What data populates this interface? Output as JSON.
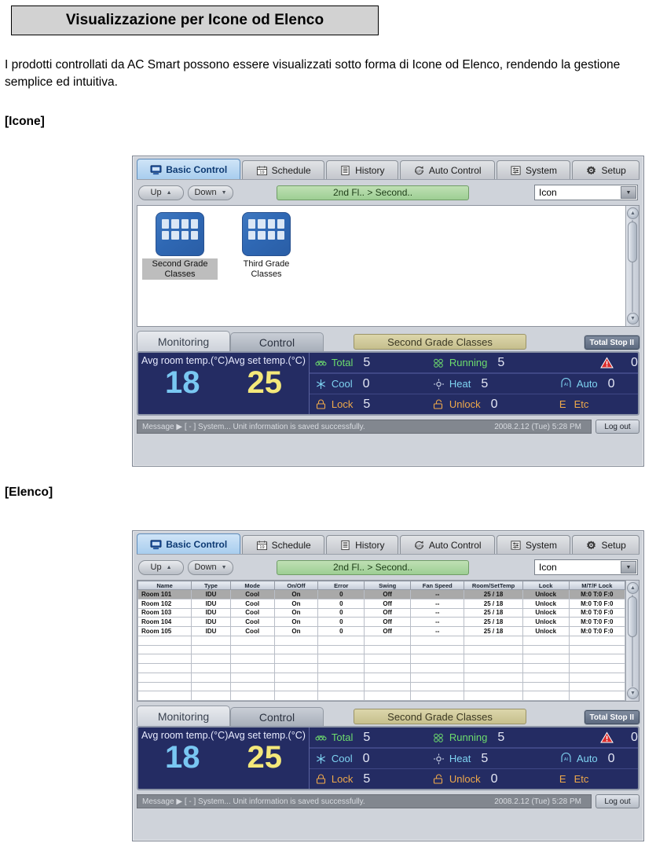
{
  "document": {
    "title": "Visualizzazione per Icone od Elenco",
    "paragraph": "I prodotti controllati da AC Smart possono essere visualizzati sotto forma di Icone od Elenco, rendendo la gestione semplice ed intuitiva.",
    "section_icons_label": "[Icone]",
    "section_list_label": "[Elenco]"
  },
  "app": {
    "tabs": [
      {
        "label": "Basic Control",
        "icon": "monitor-icon",
        "active": true
      },
      {
        "label": "Schedule",
        "icon": "calendar-icon",
        "active": false
      },
      {
        "label": "History",
        "icon": "list-document-icon",
        "active": false
      },
      {
        "label": "Auto Control",
        "icon": "auto-cycle-icon",
        "active": false
      },
      {
        "label": "System",
        "icon": "sliders-icon",
        "active": false
      },
      {
        "label": "Setup",
        "icon": "gear-icon",
        "active": false
      }
    ],
    "toolbar": {
      "up_label": "Up",
      "down_label": "Down",
      "location": "2nd Fl.. > Second..",
      "view_mode": "Icon"
    },
    "icons_view": {
      "folders": [
        {
          "label": "Second Grade Classes",
          "selected": true
        },
        {
          "label": "Third Grade Classes",
          "selected": false
        }
      ]
    },
    "list_view": {
      "columns": [
        "Name",
        "Type",
        "Mode",
        "On/Off",
        "Error",
        "Swing",
        "Fan Speed",
        "Room/SetTemp",
        "Lock",
        "M/T/F Lock"
      ],
      "rows": [
        {
          "cells": [
            "Room 101",
            "IDU",
            "Cool",
            "On",
            "0",
            "Off",
            "--",
            "25 / 18",
            "Unlock",
            "M:0 T:0 F:0"
          ],
          "selected": true
        },
        {
          "cells": [
            "Room 102",
            "IDU",
            "Cool",
            "On",
            "0",
            "Off",
            "--",
            "25 / 18",
            "Unlock",
            "M:0 T:0 F:0"
          ],
          "selected": false
        },
        {
          "cells": [
            "Room 103",
            "IDU",
            "Cool",
            "On",
            "0",
            "Off",
            "--",
            "25 / 18",
            "Unlock",
            "M:0 T:0 F:0"
          ],
          "selected": false
        },
        {
          "cells": [
            "Room 104",
            "IDU",
            "Cool",
            "On",
            "0",
            "Off",
            "--",
            "25 / 18",
            "Unlock",
            "M:0 T:0 F:0"
          ],
          "selected": false
        },
        {
          "cells": [
            "Room 105",
            "IDU",
            "Cool",
            "On",
            "0",
            "Off",
            "--",
            "25 / 18",
            "Unlock",
            "M:0 T:0 F:0"
          ],
          "selected": false
        }
      ],
      "empty_rows": 7
    },
    "bottom_tabs": {
      "monitoring_label": "Monitoring",
      "control_label": "Control",
      "zone_label": "Second Grade Classes",
      "total_stop_label": "Total Stop II"
    },
    "status_board": {
      "avg_room_temp_label": "Avg room temp.(°C)",
      "avg_set_temp_label": "Avg set temp.(°C)",
      "avg_room_temp_value": "18",
      "avg_set_temp_value": "25",
      "row1": [
        {
          "icon": "units-icon",
          "label": "Total",
          "value": "5",
          "color": "#6ddc6d"
        },
        {
          "icon": "fan-icon",
          "label": "Running",
          "value": "5",
          "color": "#6ddc6d"
        },
        {
          "icon": "alarm-triangle-icon",
          "label": "",
          "value": "0",
          "color": "#e8eaf7"
        }
      ],
      "row2": [
        {
          "icon": "snowflake-icon",
          "label": "Cool",
          "value": "0",
          "color": "#7fd4f2"
        },
        {
          "icon": "sun-icon",
          "label": "Heat",
          "value": "5",
          "color": "#7fd4f2"
        },
        {
          "icon": "ai-auto-icon",
          "label": "Auto",
          "value": "0",
          "color": "#7fd4f2"
        }
      ],
      "row3": [
        {
          "icon": "lock-closed-icon",
          "label": "Lock",
          "value": "5",
          "color": "#efa94a"
        },
        {
          "icon": "lock-open-icon",
          "label": "Unlock",
          "value": "0",
          "color": "#efa94a"
        },
        {
          "icon": "e-letter-icon",
          "label": "Etc",
          "value": "",
          "color": "#efa94a"
        }
      ]
    },
    "message_bar": {
      "text": "Message ▶ [ - ] System... Unit information is saved successfully.",
      "timestamp": "2008.2.12 (Tue)  5:28 PM",
      "logout_label": "Log out"
    },
    "colors": {
      "board_bg": "#242c63",
      "accent_green": "#6ddc6d",
      "accent_cyan": "#7fd4f2",
      "accent_orange": "#efa94a",
      "room_temp": "#79c7f2",
      "set_temp": "#f4e87a",
      "location_banner": "#9dce93",
      "zone_banner": "#c6bf8d"
    }
  }
}
